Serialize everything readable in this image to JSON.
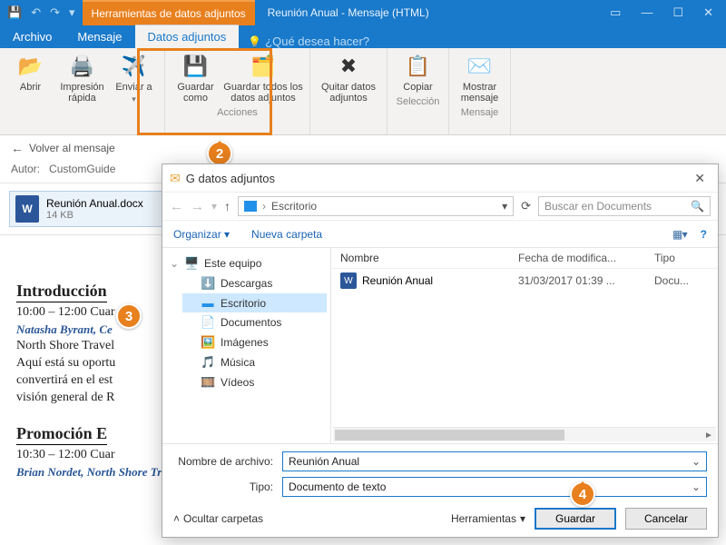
{
  "titlebar": {
    "context_tab": "Herramientas de datos adjuntos",
    "window_title": "Reunión Anual - Mensaje (HTML)"
  },
  "tabs": {
    "file": "Archivo",
    "mensaje": "Mensaje",
    "attachments": "Datos adjuntos",
    "tellme": "¿Qué desea hacer?"
  },
  "ribbon": {
    "open": "Abrir",
    "quickprint": "Impresión rápida",
    "sendto": "Enviar a",
    "saveas": "Guardar como",
    "saveall": "Guardar todos los datos adjuntos",
    "remove": "Quitar datos adjuntos",
    "copy": "Copiar",
    "showmsg": "Mostrar mensaje",
    "grp_acciones": "Acciones",
    "grp_seleccion": "Selección",
    "grp_mensaje": "Mensaje"
  },
  "msgbar": {
    "back": "Volver al mensaje"
  },
  "author": {
    "label": "Autor:",
    "value": "CustomGuide"
  },
  "attachment": {
    "name": "Reunión Anual.docx",
    "size": "14 KB"
  },
  "doc": {
    "h1": "Introducción",
    "t1": "10:00 – 12:00  Cuar",
    "p1": "Natasha Byrant, Ce",
    "l1a": "North Shore Travel",
    "l1b": "Aquí está su oportu",
    "l1c": "convertirá en el est",
    "l1d": "visión general de R",
    "h2": "Promoción E",
    "t2": "10:30 – 12:00  Cuar",
    "p2": "Brian Nordet, North Shore Travel"
  },
  "dialog": {
    "title": "Guardar datos adjuntos",
    "title_visible": "G          datos adjuntos",
    "path": "Escritorio",
    "search_placeholder": "Buscar en Documents",
    "organize": "Organizar",
    "newfolder": "Nueva carpeta",
    "tree": {
      "root": "Este equipo",
      "downloads": "Descargas",
      "desktop": "Escritorio",
      "documents": "Documentos",
      "images": "Imágenes",
      "music": "Música",
      "videos": "Vídeos"
    },
    "cols": {
      "name": "Nombre",
      "date": "Fecha de modifica...",
      "type": "Tipo"
    },
    "file": {
      "name": "Reunión Anual",
      "date": "31/03/2017 01:39 ...",
      "type": "Docu..."
    },
    "fld_name_label": "Nombre de archivo:",
    "fld_name_value": "Reunión Anual",
    "fld_type_label": "Tipo:",
    "fld_type_value": "Documento de texto",
    "hide_folders": "Ocultar carpetas",
    "tools": "Herramientas",
    "save": "Guardar",
    "cancel": "Cancelar"
  },
  "callouts": {
    "c2": "2",
    "c3": "3",
    "c4": "4"
  }
}
